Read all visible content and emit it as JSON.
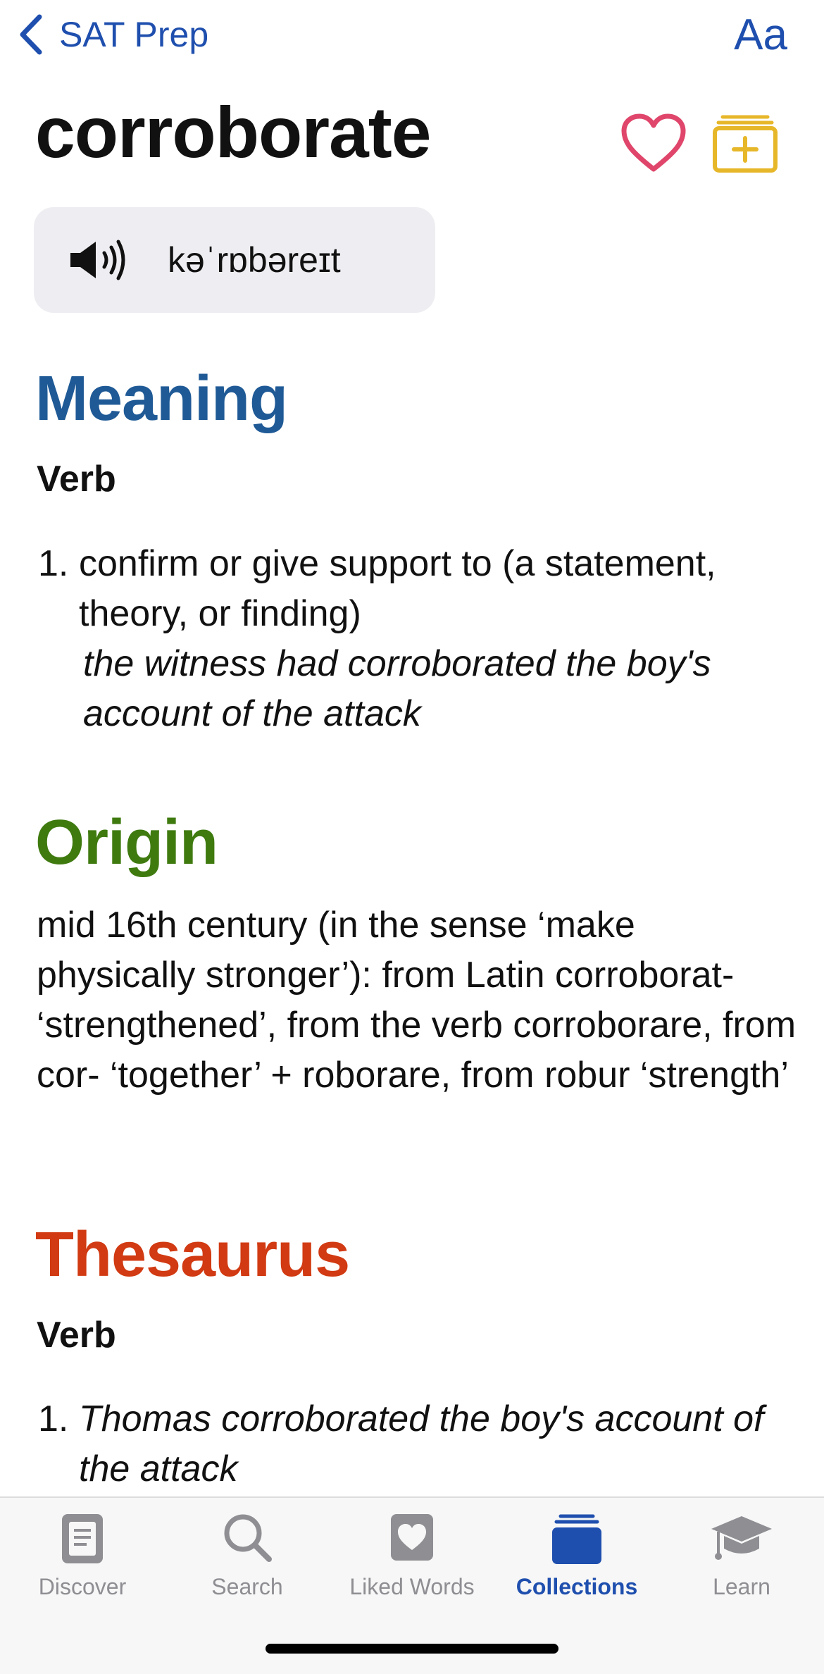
{
  "nav": {
    "back_label": "SAT Prep",
    "font_button": "Aa"
  },
  "word": "corroborate",
  "pronunciation": {
    "ipa": "kəˈrɒbəreɪt",
    "icon": "speaker-icon"
  },
  "meaning": {
    "title": "Meaning",
    "pos": "Verb",
    "items": [
      {
        "number": "1.",
        "definition": "confirm or give support to (a statement, theory, or finding)",
        "example": "the witness had corroborated the boy's account of the attack"
      }
    ]
  },
  "origin": {
    "title": "Origin",
    "text": "mid 16th century (in the sense ‘make physically stronger’): from Latin corroborat- ‘strengthened’, from the verb corroborare, from cor- ‘together’ + roborare, from robur ‘strength’"
  },
  "thesaurus": {
    "title": "Thesaurus",
    "pos": "Verb",
    "items": [
      {
        "number": "1.",
        "example": "Thomas corroborated the boy's account of the attack"
      }
    ]
  },
  "tabs": [
    {
      "label": "Discover",
      "icon": "book-icon",
      "active": false
    },
    {
      "label": "Search",
      "icon": "search-icon",
      "active": false
    },
    {
      "label": "Liked Words",
      "icon": "heart-icon",
      "active": false
    },
    {
      "label": "Collections",
      "icon": "collections-icon",
      "active": true
    },
    {
      "label": "Learn",
      "icon": "graduation-cap-icon",
      "active": false
    }
  ],
  "colors": {
    "accent": "#1f4fae",
    "meaning": "#1f5a96",
    "origin": "#3f7a0f",
    "thesaurus": "#d13a12",
    "heart": "#e0466b",
    "collect": "#e7b72a",
    "inactive_tab": "#8e8e93"
  }
}
